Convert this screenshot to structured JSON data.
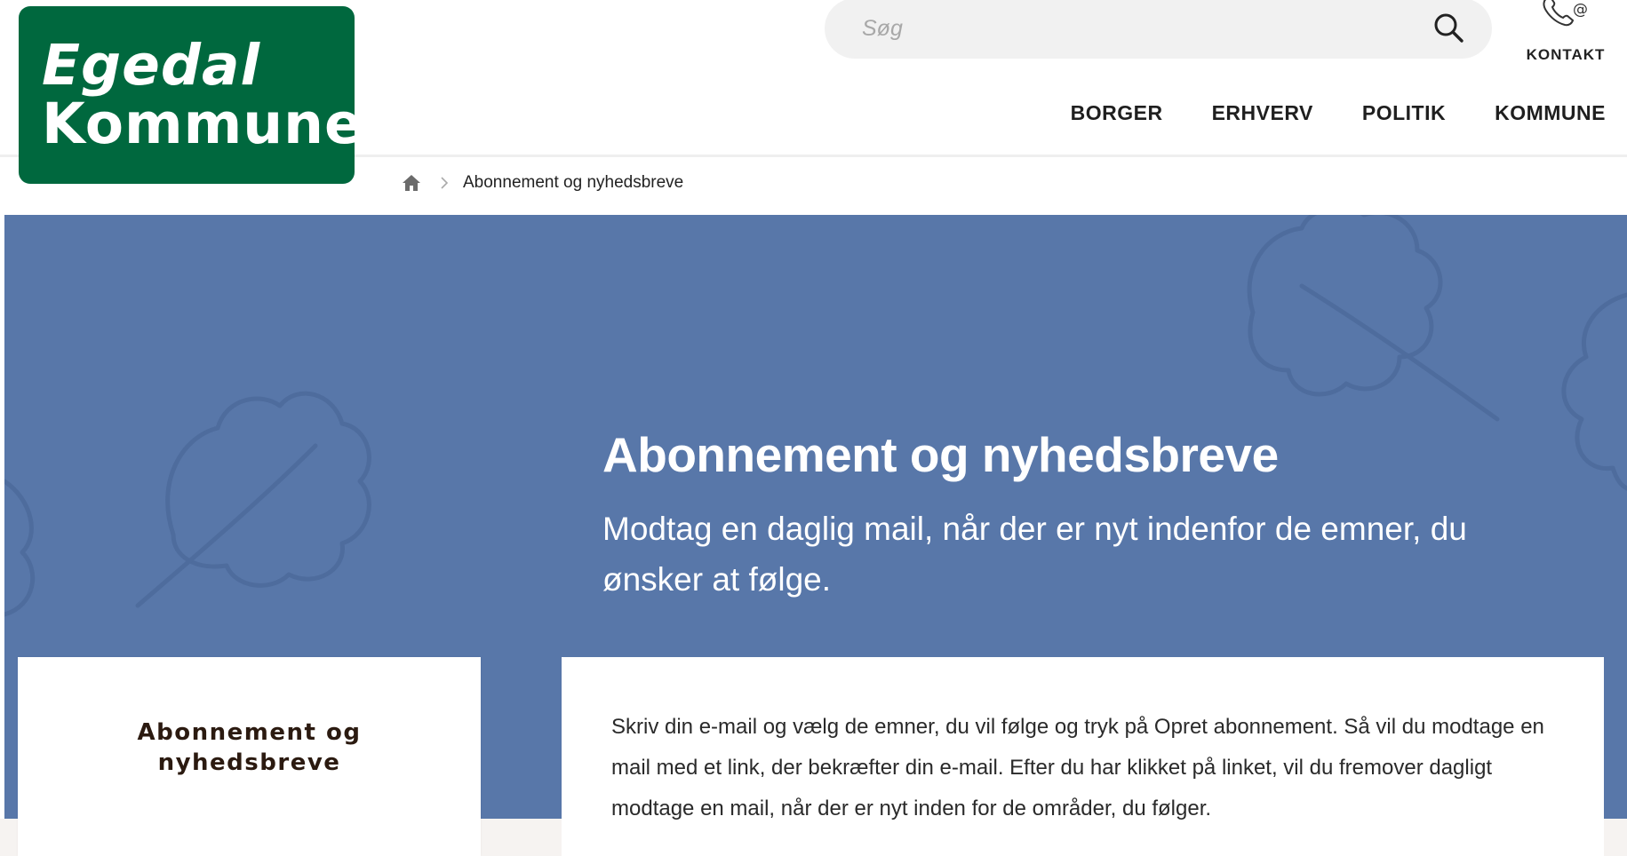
{
  "header": {
    "logo_line1": "Egedal",
    "logo_line2": "Kommune",
    "search_placeholder": "Søg",
    "contact_label": "KONTAKT",
    "nav": [
      "BORGER",
      "ERHVERV",
      "POLITIK",
      "KOMMUNE"
    ]
  },
  "breadcrumb": {
    "current": "Abonnement og nyhedsbreve"
  },
  "hero": {
    "title": "Abonnement og nyhedsbreve",
    "subtitle": "Modtag en daglig mail, når der er nyt indenfor de emner, du ønsker at følge."
  },
  "side_card": {
    "title_line1": "Abonnement og",
    "title_line2": "nyhedsbreve"
  },
  "main_card": {
    "text": "Skriv din e-mail og vælg de emner, du vil følge og tryk på Opret abonnement. Så vil du modtage en mail med et link, der bekræfter din e-mail. Efter du har klikket på linket, vil du fremover dagligt modtage en mail, når der er nyt inden for de områder, du følger."
  },
  "colors": {
    "brand_green": "#00683e",
    "hero_blue": "#5877a9",
    "text_dark": "#1b1b1b"
  },
  "icons": [
    "search-icon",
    "contact-phone-icon",
    "home-icon",
    "chevron-right-icon",
    "oak-leaf-icon"
  ]
}
